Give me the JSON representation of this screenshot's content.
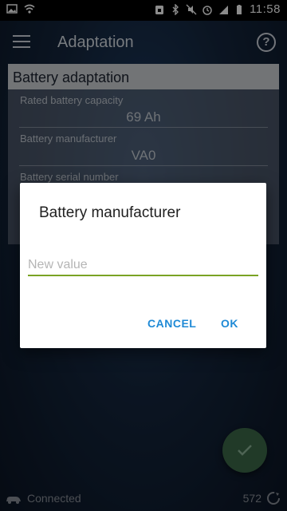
{
  "status_bar": {
    "time": "11:58"
  },
  "app_bar": {
    "title": "Adaptation",
    "help_symbol": "?"
  },
  "card": {
    "header": "Battery adaptation",
    "fields": [
      {
        "label": "Rated battery capacity",
        "value": "69 Ah"
      },
      {
        "label": "Battery manufacturer",
        "value": "VA0"
      },
      {
        "label": "Battery serial number",
        "value": ""
      }
    ]
  },
  "dialog": {
    "title": "Battery manufacturer",
    "input_placeholder": "New value",
    "input_value": "",
    "cancel_label": "CANCEL",
    "ok_label": "OK"
  },
  "bottom_bar": {
    "connection_status": "Connected",
    "count": "572"
  },
  "colors": {
    "accent_blue": "#1f8ad6",
    "input_underline": "#7aa324",
    "fab": "#3c6a49"
  }
}
